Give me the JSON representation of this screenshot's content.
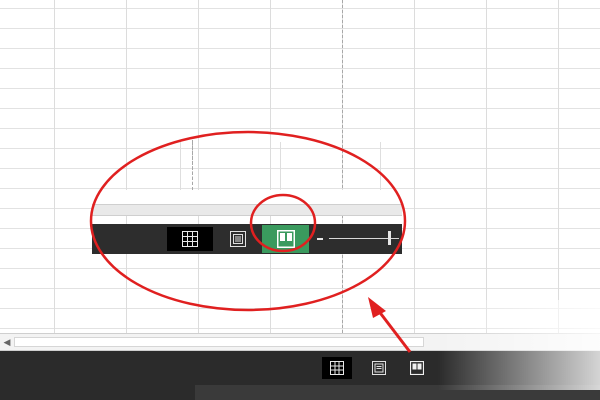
{
  "colors": {
    "page_break_view_active": "#3a9a5e",
    "status_bar": "#2b2b2b",
    "annotation_red": "#e02020"
  },
  "icons": {
    "normal_view": "grid-icon",
    "page_layout_view": "page-layout-icon",
    "page_break_preview": "page-break-icon",
    "scroll_left": "triangle-left-icon"
  },
  "status_bar": {
    "view_buttons": [
      "normal",
      "page-layout",
      "page-break-preview"
    ],
    "active_view": "page-break-preview"
  },
  "scrollbar": {
    "left_arrow_glyph": "◀"
  },
  "annotation": {
    "highlighted_button": "page-break-preview",
    "shapes": [
      "zoom-ellipse",
      "highlight-circle",
      "pointer-arrow"
    ]
  }
}
